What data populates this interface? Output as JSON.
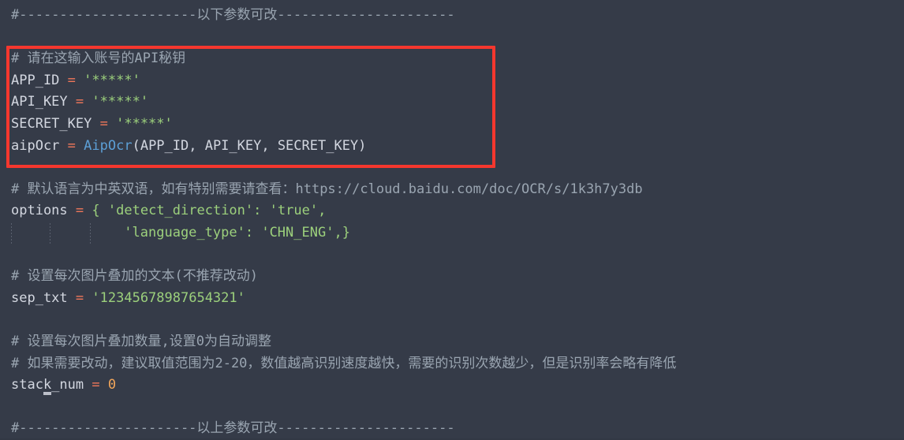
{
  "editor": {
    "theme_background": "#353b48",
    "default_text_color": "#d3d7e0",
    "comment_color": "#9aa5b1",
    "string_color": "#9cd07c",
    "operator_color": "#f0775a",
    "function_color": "#5c9fd6",
    "number_color": "#f2a65a",
    "highlight_box_color": "#f5372e",
    "language": "Python"
  },
  "lines": {
    "l1_sep_top_hash": "#",
    "l1_sep_top_dashes_left": "----------------------",
    "l1_sep_top_title": "以下参数可改",
    "l1_sep_top_dashes_right": "----------------------",
    "l3_comment_api": "# 请在这输入账号的API秘钥",
    "l4_name": "APP_ID",
    "l4_op": "=",
    "l4_value": "'*****'",
    "l5_name": "API_KEY",
    "l5_op": "=",
    "l5_value": "'*****'",
    "l6_name": "SECRET_KEY",
    "l6_op": "=",
    "l6_value": "'*****'",
    "l7_name": "aipOcr",
    "l7_op": "=",
    "l7_func": "AipOcr",
    "l7_args": "(APP_ID, API_KEY, SECRET_KEY)",
    "l9_comment_lang": "# 默认语言为中英双语，如有特别需要请查看：",
    "l9_url": "https://cloud.baidu.com/doc/OCR/s/1k3h7y3db",
    "l10_name": "options",
    "l10_op": "=",
    "l10_brace_open": "{",
    "l10_key": "'detect_direction'",
    "l10_colon": ":",
    "l10_val": "'true'",
    "l10_comma": ",",
    "l11_indent": "              ",
    "l11_key": "'language_type'",
    "l11_colon": ":",
    "l11_val": "'CHN_ENG'",
    "l11_tail": ",}",
    "l13_comment_sep": "# 设置每次图片叠加的文本(不推荐改动)",
    "l14_name": "sep_txt",
    "l14_op": "=",
    "l14_value": "'12345678987654321'",
    "l16_comment_stack1": "# 设置每次图片叠加数量,设置0为自动调整",
    "l17_comment_stack2": "# 如果需要改动，建议取值范围为2-20，数值越高识别速度越快，需要的识别次数越少，但是识别率会略有降低",
    "l18_name": "stack_num",
    "l18_op": "=",
    "l18_value": "0",
    "l20_sep_bottom_hash": "#",
    "l20_sep_bottom_dashes_left": "----------------------",
    "l20_sep_bottom_title": "以上参数可改",
    "l20_sep_bottom_dashes_right": "----------------------"
  }
}
